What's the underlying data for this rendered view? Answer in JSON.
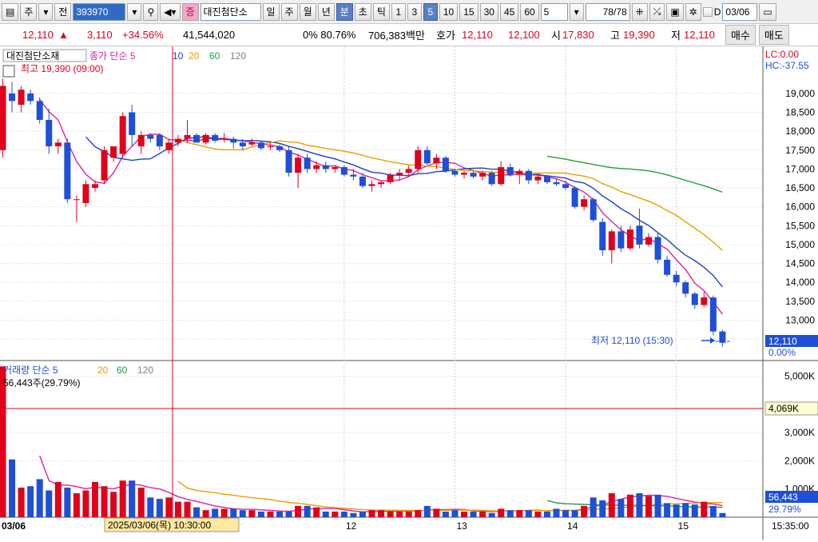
{
  "toolbar": {
    "market_label": "주",
    "scope_label": "전",
    "code_value": "393970",
    "stock_name": "대진첨단소",
    "period_buttons": [
      "일",
      "주",
      "월",
      "년",
      "분",
      "초",
      "틱"
    ],
    "interval_buttons": [
      "1",
      "3",
      "5",
      "10",
      "15",
      "30",
      "45",
      "60"
    ],
    "interval_select": "5",
    "count_value": "78",
    "count_total": "/78",
    "date_value": "03/06"
  },
  "quote": {
    "price": "12,110",
    "change": "3,110",
    "change_pct": "+34.56%",
    "volume": "41,544,020",
    "ratio": "0%  80.76%",
    "amount": "706,383백만",
    "bid_label": "호가",
    "bid_ask": "12,110",
    "bid_bid": "12,100",
    "open_label": "시",
    "open": "17,830",
    "high_label": "고",
    "high": "19,390",
    "low_label": "저",
    "low": "12,110",
    "buy_label": "매수",
    "sell_label": "매도"
  },
  "price_panel": {
    "name_tag": "대진첨단소재",
    "legend_title": "종가 단순 5",
    "legend_periods": [
      "10",
      "20",
      "60",
      "120"
    ],
    "max_label": "최고 19,390 (09:00)",
    "min_label": "최저 12,110 (15:30)",
    "lc_label": "LC:0.00",
    "hc_label": "HC:-37.55",
    "last_price": "12,110",
    "last_pct": "0.00%"
  },
  "volume_panel": {
    "legend_title": "거래량 단순 5",
    "legend_periods": [
      "20",
      "60",
      "120"
    ],
    "info_label": "56,443주(29.79%)",
    "ref_label": "4,069K",
    "last_value": "56,443",
    "last_pct": "29.79%"
  },
  "xaxis": {
    "start_label": "03/06",
    "crosshair_label": "2025/03/06(목) 10:30:00",
    "day_labels": [
      "12",
      "13",
      "14",
      "15"
    ],
    "end_time": "15:35:00"
  },
  "colors": {
    "up": "#e0001b",
    "down": "#1e4fd6",
    "ma5": "#e020a0",
    "ma10": "#2040c8",
    "ma20": "#e8a000",
    "ma60": "#20a040",
    "ma120": "#808080"
  },
  "chart_data": {
    "type": "candlestick",
    "price_ylim": [
      12100,
      19400
    ],
    "price_ticks": [
      12500,
      13000,
      13500,
      14000,
      14500,
      15000,
      15500,
      16000,
      16500,
      17000,
      17500,
      18000,
      18500,
      19000
    ],
    "volume_ticks": [
      "1,000K",
      "2,000K",
      "3,000K",
      "5,000K"
    ],
    "volume_ylim": [
      0,
      5500
    ],
    "candles": [
      {
        "o": 17500,
        "h": 19390,
        "l": 17300,
        "c": 19200
      },
      {
        "o": 19000,
        "h": 19300,
        "l": 18500,
        "c": 18800
      },
      {
        "o": 18700,
        "h": 19200,
        "l": 18500,
        "c": 19100
      },
      {
        "o": 19000,
        "h": 19100,
        "l": 18700,
        "c": 18800
      },
      {
        "o": 18800,
        "h": 18900,
        "l": 18200,
        "c": 18300
      },
      {
        "o": 18300,
        "h": 18600,
        "l": 17400,
        "c": 17600
      },
      {
        "o": 17600,
        "h": 17800,
        "l": 17400,
        "c": 17700
      },
      {
        "o": 17700,
        "h": 17800,
        "l": 16100,
        "c": 16200
      },
      {
        "o": 16200,
        "h": 16300,
        "l": 15600,
        "c": 16200
      },
      {
        "o": 16100,
        "h": 16700,
        "l": 16000,
        "c": 16600
      },
      {
        "o": 16500,
        "h": 16700,
        "l": 16400,
        "c": 16600
      },
      {
        "o": 16700,
        "h": 17600,
        "l": 16600,
        "c": 17500
      },
      {
        "o": 17300,
        "h": 17600,
        "l": 17200,
        "c": 17600
      },
      {
        "o": 17400,
        "h": 18500,
        "l": 17300,
        "c": 18400
      },
      {
        "o": 18500,
        "h": 18700,
        "l": 17600,
        "c": 17900
      },
      {
        "o": 17600,
        "h": 18000,
        "l": 17400,
        "c": 17900
      },
      {
        "o": 17900,
        "h": 17950,
        "l": 17700,
        "c": 17800
      },
      {
        "o": 17900,
        "h": 17950,
        "l": 17500,
        "c": 17600
      },
      {
        "o": 17500,
        "h": 17800,
        "l": 17400,
        "c": 17700
      },
      {
        "o": 17700,
        "h": 17900,
        "l": 17600,
        "c": 17800
      },
      {
        "o": 17800,
        "h": 18300,
        "l": 17700,
        "c": 17900
      },
      {
        "o": 17900,
        "h": 17950,
        "l": 17700,
        "c": 17700
      },
      {
        "o": 17700,
        "h": 17950,
        "l": 17650,
        "c": 17900
      },
      {
        "o": 17900,
        "h": 17950,
        "l": 17700,
        "c": 17750
      },
      {
        "o": 17800,
        "h": 17950,
        "l": 17700,
        "c": 17800
      },
      {
        "o": 17800,
        "h": 17850,
        "l": 17550,
        "c": 17700
      },
      {
        "o": 17700,
        "h": 17800,
        "l": 17500,
        "c": 17600
      },
      {
        "o": 17650,
        "h": 17800,
        "l": 17600,
        "c": 17700
      },
      {
        "o": 17700,
        "h": 17750,
        "l": 17500,
        "c": 17550
      },
      {
        "o": 17600,
        "h": 17700,
        "l": 17500,
        "c": 17600
      },
      {
        "o": 17600,
        "h": 17650,
        "l": 17450,
        "c": 17500
      },
      {
        "o": 17500,
        "h": 17600,
        "l": 16800,
        "c": 16900
      },
      {
        "o": 16900,
        "h": 17400,
        "l": 16500,
        "c": 17300
      },
      {
        "o": 17300,
        "h": 17400,
        "l": 16900,
        "c": 17000
      },
      {
        "o": 17000,
        "h": 17200,
        "l": 16900,
        "c": 17100
      },
      {
        "o": 17100,
        "h": 17200,
        "l": 16900,
        "c": 17000
      },
      {
        "o": 17000,
        "h": 17100,
        "l": 16900,
        "c": 17050
      },
      {
        "o": 17050,
        "h": 17100,
        "l": 16800,
        "c": 16850
      },
      {
        "o": 16850,
        "h": 17000,
        "l": 16700,
        "c": 16800
      },
      {
        "o": 16800,
        "h": 16900,
        "l": 16500,
        "c": 16550
      },
      {
        "o": 16550,
        "h": 16700,
        "l": 16400,
        "c": 16600
      },
      {
        "o": 16600,
        "h": 16700,
        "l": 16500,
        "c": 16650
      },
      {
        "o": 16650,
        "h": 16900,
        "l": 16600,
        "c": 16850
      },
      {
        "o": 16850,
        "h": 17000,
        "l": 16700,
        "c": 16900
      },
      {
        "o": 16900,
        "h": 17100,
        "l": 16800,
        "c": 17000
      },
      {
        "o": 17000,
        "h": 17600,
        "l": 16900,
        "c": 17500
      },
      {
        "o": 17500,
        "h": 17600,
        "l": 17100,
        "c": 17150
      },
      {
        "o": 17150,
        "h": 17400,
        "l": 17000,
        "c": 17300
      },
      {
        "o": 17300,
        "h": 17350,
        "l": 16900,
        "c": 16950
      },
      {
        "o": 16950,
        "h": 17000,
        "l": 16800,
        "c": 16850
      },
      {
        "o": 16850,
        "h": 16950,
        "l": 16750,
        "c": 16900
      },
      {
        "o": 16900,
        "h": 16950,
        "l": 16750,
        "c": 16800
      },
      {
        "o": 16800,
        "h": 16950,
        "l": 16700,
        "c": 16900
      },
      {
        "o": 16900,
        "h": 16950,
        "l": 16550,
        "c": 16600
      },
      {
        "o": 16600,
        "h": 17200,
        "l": 16550,
        "c": 17050
      },
      {
        "o": 17050,
        "h": 17150,
        "l": 16800,
        "c": 16850
      },
      {
        "o": 16850,
        "h": 17000,
        "l": 16600,
        "c": 16950
      },
      {
        "o": 16950,
        "h": 17000,
        "l": 16600,
        "c": 16700
      },
      {
        "o": 16700,
        "h": 16850,
        "l": 16600,
        "c": 16800
      },
      {
        "o": 16800,
        "h": 16850,
        "l": 16600,
        "c": 16650
      },
      {
        "o": 16650,
        "h": 16750,
        "l": 16550,
        "c": 16600
      },
      {
        "o": 16600,
        "h": 16700,
        "l": 16450,
        "c": 16500
      },
      {
        "o": 16500,
        "h": 16550,
        "l": 15950,
        "c": 16000
      },
      {
        "o": 16000,
        "h": 16300,
        "l": 15900,
        "c": 16200
      },
      {
        "o": 16200,
        "h": 16250,
        "l": 15600,
        "c": 15650
      },
      {
        "o": 15600,
        "h": 15700,
        "l": 14700,
        "c": 14850
      },
      {
        "o": 14850,
        "h": 15400,
        "l": 14500,
        "c": 15350
      },
      {
        "o": 15350,
        "h": 15500,
        "l": 14800,
        "c": 14900
      },
      {
        "o": 14900,
        "h": 15500,
        "l": 14850,
        "c": 15400
      },
      {
        "o": 15500,
        "h": 15950,
        "l": 14900,
        "c": 15000
      },
      {
        "o": 15000,
        "h": 15300,
        "l": 14950,
        "c": 15200
      },
      {
        "o": 15200,
        "h": 15300,
        "l": 14500,
        "c": 14600
      },
      {
        "o": 14600,
        "h": 14700,
        "l": 14150,
        "c": 14200
      },
      {
        "o": 14200,
        "h": 14300,
        "l": 13900,
        "c": 14000
      },
      {
        "o": 14000,
        "h": 14050,
        "l": 13600,
        "c": 13700
      },
      {
        "o": 13700,
        "h": 13750,
        "l": 13300,
        "c": 13400
      },
      {
        "o": 13400,
        "h": 13750,
        "l": 13350,
        "c": 13600
      },
      {
        "o": 13600,
        "h": 13650,
        "l": 12600,
        "c": 12700
      },
      {
        "o": 12700,
        "h": 12750,
        "l": 12300,
        "c": 12400
      }
    ],
    "volumes": [
      5350,
      2050,
      1050,
      1100,
      1350,
      950,
      1250,
      1050,
      850,
      950,
      1250,
      1100,
      900,
      1300,
      1300,
      1050,
      700,
      650,
      700,
      550,
      550,
      350,
      250,
      300,
      300,
      300,
      250,
      250,
      200,
      200,
      200,
      200,
      400,
      400,
      350,
      200,
      200,
      200,
      150,
      200,
      250,
      250,
      200,
      200,
      200,
      250,
      400,
      300,
      200,
      250,
      200,
      200,
      200,
      150,
      300,
      250,
      250,
      250,
      200,
      200,
      300,
      250,
      250,
      400,
      700,
      600,
      850,
      650,
      800,
      850,
      750,
      800,
      500,
      450,
      500,
      450,
      550,
      400,
      150
    ]
  }
}
